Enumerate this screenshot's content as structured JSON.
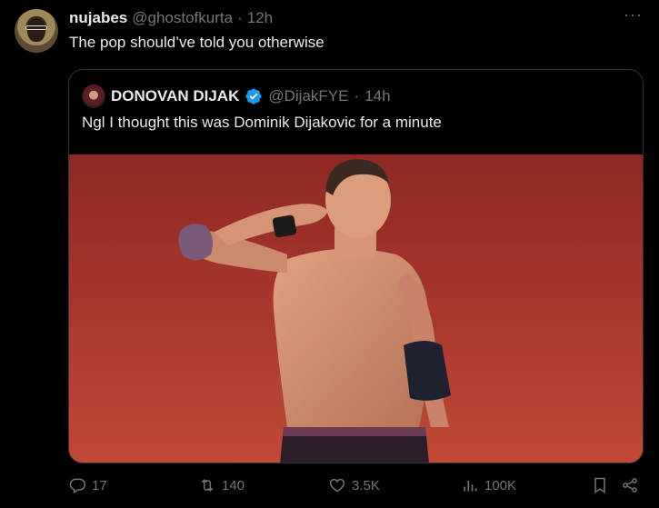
{
  "tweet": {
    "display_name": "nujabes",
    "handle": "@ghostofkurta",
    "separator": "·",
    "time": "12h",
    "text": "The pop should’ve told you otherwise",
    "more_label": "···"
  },
  "quoted": {
    "display_name": "DONOVAN DIJAK",
    "handle": "@DijakFYE",
    "separator": "·",
    "time": "14h",
    "text": "Ngl I thought this was Dominik Dijakovic for a minute",
    "verified_color": "#1d9bf0"
  },
  "actions": {
    "replies": "17",
    "retweets": "140",
    "likes": "3.5K",
    "views": "100K"
  },
  "icons": [
    "reply-icon",
    "retweet-icon",
    "like-icon",
    "views-icon",
    "bookmark-icon",
    "share-icon"
  ],
  "colors": {
    "background": "#000000",
    "text": "#e7e9ea",
    "muted": "#71767b",
    "border": "#2f3336"
  }
}
